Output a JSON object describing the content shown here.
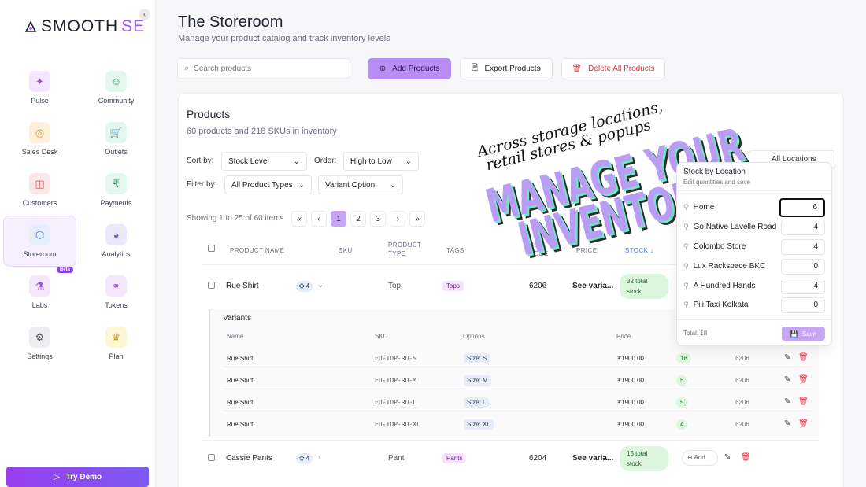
{
  "brand": {
    "logo_main": "SMOOTH",
    "logo_accent": "SE",
    "accent": "#9b57ee"
  },
  "sidebar": {
    "items": [
      {
        "label": "Pulse",
        "icon": "sparkle-icon",
        "bg": "#f3e6fd",
        "fg": "#a04de8"
      },
      {
        "label": "Community",
        "icon": "users-icon",
        "bg": "#e3f7ee",
        "fg": "#2d9b6a"
      },
      {
        "label": "Sales Desk",
        "icon": "coins-icon",
        "bg": "#fdf2d9",
        "fg": "#d2962a"
      },
      {
        "label": "Outlets",
        "icon": "cart-icon",
        "bg": "#e3f7ee",
        "fg": "#2d9b6a"
      },
      {
        "label": "Customers",
        "icon": "customers-icon",
        "bg": "#fde6e7",
        "fg": "#e0505a"
      },
      {
        "label": "Payments",
        "icon": "rupee-icon",
        "bg": "#e3f7ee",
        "fg": "#2d9b6a"
      },
      {
        "label": "Storeroom",
        "icon": "box-icon",
        "bg": "#e6eefb",
        "fg": "#4a72d6"
      },
      {
        "label": "Analytics",
        "icon": "chart-icon",
        "bg": "#ece8fb",
        "fg": "#6a52d6"
      },
      {
        "label": "Labs",
        "icon": "flask-icon",
        "bg": "#f3e6fd",
        "fg": "#a04de8",
        "badge": "Beta"
      },
      {
        "label": "Tokens",
        "icon": "tokens-icon",
        "bg": "#f3e6fd",
        "fg": "#a04de8"
      },
      {
        "label": "Settings",
        "icon": "gear-icon",
        "bg": "#eeeef2",
        "fg": "#555"
      },
      {
        "label": "Plan",
        "icon": "crown-icon",
        "bg": "#fdf7d5",
        "fg": "#c9a417"
      }
    ],
    "demo_button": "Try Demo"
  },
  "header": {
    "title": "The Storeroom",
    "subtitle": "Manage your product catalog and track inventory levels",
    "search_placeholder": "Search products",
    "add_label": "Add Products",
    "export_label": "Export Products",
    "delete_label": "Delete All Products"
  },
  "products": {
    "title": "Products",
    "subtitle": "60 products and 218 SKUs in inventory",
    "sort_label": "Sort by:",
    "sort_value": "Stock Level",
    "order_label": "Order:",
    "order_value": "High to Low",
    "filter_label": "Filter by:",
    "type_value": "All Product Types",
    "variant_value": "Variant Option",
    "location_value": "All Locations",
    "showing": "Showing 1 to 25 of 60 items",
    "pages": [
      "1",
      "2",
      "3"
    ],
    "current_page": "1",
    "columns": [
      "PRODUCT NAME",
      "SKU",
      "PRODUCT TYPE",
      "TAGS",
      "HSN CODE",
      "PRICE",
      "STOCK"
    ],
    "rows": [
      {
        "name": "Rue Shirt",
        "sku_count": "4",
        "type": "Top",
        "tag": "Tops",
        "hsn": "6206",
        "price": "See varia...",
        "stock": "32 total stock"
      },
      {
        "name": "Cassie Pants",
        "sku_count": "4",
        "type": "Pant",
        "tag": "Pants",
        "hsn": "6204",
        "price": "See varia...",
        "stock": "15 total stock",
        "add": "Add"
      }
    ],
    "variants": {
      "title": "Variants",
      "columns": [
        "Name",
        "SKU",
        "Options",
        "Price"
      ],
      "rows": [
        {
          "name": "Rue Shirt",
          "sku": "EU-TOP-RU-S",
          "option": "Size: S",
          "price": "₹1900.00",
          "stock": "18",
          "hsn": "6206"
        },
        {
          "name": "Rue Shirt",
          "sku": "EU-TOP-RU-M",
          "option": "Size: M",
          "price": "₹1900.00",
          "stock": "5",
          "hsn": "6206"
        },
        {
          "name": "Rue Shirt",
          "sku": "EU-TOP-RU-L",
          "option": "Size: L",
          "price": "₹1900.00",
          "stock": "5",
          "hsn": "6206"
        },
        {
          "name": "Rue Shirt",
          "sku": "EU-TOP-RU-XL",
          "option": "Size: XL",
          "price": "₹1900.00",
          "stock": "4",
          "hsn": "6206"
        }
      ]
    }
  },
  "stock_popover": {
    "title": "Stock by Location",
    "subtitle": "Edit quantities and save",
    "locations": [
      {
        "name": "Home",
        "qty": "6"
      },
      {
        "name": "Go Native Lavelle Road",
        "qty": "4"
      },
      {
        "name": "Colombo Store",
        "qty": "4"
      },
      {
        "name": "Lux Rackspace BKC",
        "qty": "0"
      },
      {
        "name": "A Hundred Hands",
        "qty": "4"
      },
      {
        "name": "Pili Taxi Kolkata",
        "qty": "0"
      }
    ],
    "total": "Total: 18",
    "save_label": "Save"
  },
  "promo": {
    "line1": "Across storage locations,",
    "line2": "retail stores & popups",
    "big1": "MANAGE YOUR",
    "big2": "INVENTORY"
  }
}
